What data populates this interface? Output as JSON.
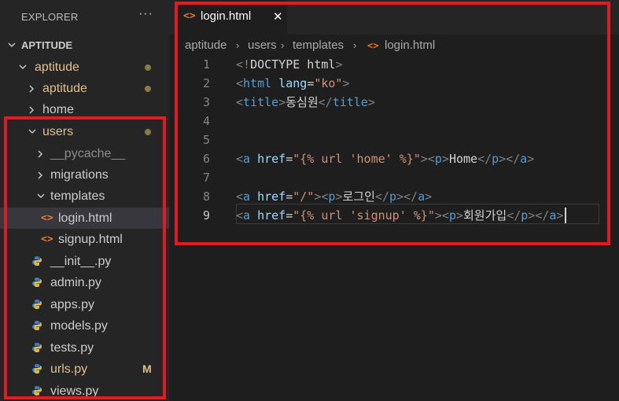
{
  "sidebar": {
    "title": "EXPLORER",
    "more": "···",
    "items": [
      {
        "label": "APTITUDE",
        "kind": "root"
      },
      {
        "label": "aptitude",
        "kind": "folder-open",
        "modified": true
      },
      {
        "label": "aptitude",
        "kind": "folder",
        "modified": true
      },
      {
        "label": "home",
        "kind": "folder"
      },
      {
        "label": "users",
        "kind": "folder-open",
        "modified": true
      },
      {
        "label": "__pycache__",
        "kind": "folder"
      },
      {
        "label": "migrations",
        "kind": "folder"
      },
      {
        "label": "templates",
        "kind": "folder-open"
      },
      {
        "label": "login.html",
        "kind": "html",
        "selected": true
      },
      {
        "label": "signup.html",
        "kind": "html"
      },
      {
        "label": "__init__.py",
        "kind": "py"
      },
      {
        "label": "admin.py",
        "kind": "py"
      },
      {
        "label": "apps.py",
        "kind": "py"
      },
      {
        "label": "models.py",
        "kind": "py"
      },
      {
        "label": "tests.py",
        "kind": "py"
      },
      {
        "label": "urls.py",
        "kind": "py",
        "badge": "M"
      },
      {
        "label": "views.py",
        "kind": "py"
      }
    ]
  },
  "editor": {
    "tab": {
      "label": "login.html",
      "close": "✕",
      "icon": "html-icon"
    },
    "breadcrumb": [
      "aptitude",
      "users",
      "templates",
      "login.html"
    ],
    "lines": [
      {
        "n": "1",
        "tokens": [
          [
            "t",
            "<!"
          ],
          [
            "x",
            "DOCTYPE html"
          ],
          [
            "t",
            ">"
          ]
        ]
      },
      {
        "n": "2",
        "tokens": [
          [
            "t",
            "<"
          ],
          [
            "n",
            "html"
          ],
          [
            "x",
            " "
          ],
          [
            "a",
            "lang"
          ],
          [
            "x",
            "="
          ],
          [
            "s",
            "\"ko\""
          ],
          [
            "t",
            ">"
          ]
        ]
      },
      {
        "n": "3",
        "tokens": [
          [
            "t",
            "<"
          ],
          [
            "n",
            "title"
          ],
          [
            "t",
            ">"
          ],
          [
            "x",
            "동심원"
          ],
          [
            "t",
            "</"
          ],
          [
            "n",
            "title"
          ],
          [
            "t",
            ">"
          ]
        ]
      },
      {
        "n": "4",
        "tokens": []
      },
      {
        "n": "5",
        "tokens": []
      },
      {
        "n": "6",
        "tokens": [
          [
            "t",
            "<"
          ],
          [
            "n",
            "a"
          ],
          [
            "x",
            " "
          ],
          [
            "a",
            "href"
          ],
          [
            "x",
            "="
          ],
          [
            "s",
            "\"{% url 'home' %}\""
          ],
          [
            "t",
            "><"
          ],
          [
            "n",
            "p"
          ],
          [
            "t",
            ">"
          ],
          [
            "x",
            "Home"
          ],
          [
            "t",
            "</"
          ],
          [
            "n",
            "p"
          ],
          [
            "t",
            "></"
          ],
          [
            "n",
            "a"
          ],
          [
            "t",
            ">"
          ]
        ]
      },
      {
        "n": "7",
        "tokens": []
      },
      {
        "n": "8",
        "tokens": [
          [
            "t",
            "<"
          ],
          [
            "n",
            "a"
          ],
          [
            "x",
            " "
          ],
          [
            "a",
            "href"
          ],
          [
            "x",
            "="
          ],
          [
            "s",
            "\"/\""
          ],
          [
            "t",
            "><"
          ],
          [
            "n",
            "p"
          ],
          [
            "t",
            ">"
          ],
          [
            "x",
            "로그인"
          ],
          [
            "t",
            "</"
          ],
          [
            "n",
            "p"
          ],
          [
            "t",
            "></"
          ],
          [
            "n",
            "a"
          ],
          [
            "t",
            ">"
          ]
        ]
      },
      {
        "n": "9",
        "tokens": [
          [
            "t",
            "<"
          ],
          [
            "n",
            "a"
          ],
          [
            "x",
            " "
          ],
          [
            "a",
            "href"
          ],
          [
            "x",
            "="
          ],
          [
            "s",
            "\"{% url 'signup' %}\""
          ],
          [
            "t",
            "><"
          ],
          [
            "n",
            "p"
          ],
          [
            "t",
            ">"
          ],
          [
            "x",
            "회원가입"
          ],
          [
            "t",
            "</"
          ],
          [
            "n",
            "p"
          ],
          [
            "t",
            "></"
          ],
          [
            "n",
            "a"
          ],
          [
            "t",
            ">"
          ]
        ],
        "active": true
      }
    ]
  },
  "colors": {
    "annotation": "#e01b24",
    "html_icon": "#e37933",
    "modified": "#e2c08d",
    "tag": "#569cd6",
    "attr": "#9cdcfe",
    "string": "#ce9178"
  }
}
